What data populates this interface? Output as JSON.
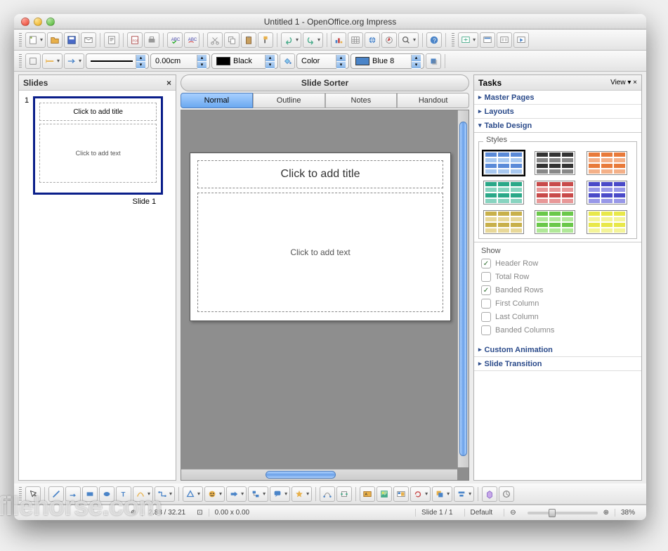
{
  "title": "Untitled 1 - OpenOffice.org Impress",
  "toolbar2": {
    "line_width": "0.00cm",
    "line_color_label": "Black",
    "area_label": "Color",
    "fill_color_label": "Blue 8"
  },
  "slides_panel": {
    "title": "Slides",
    "thumb_title": "Click to add title",
    "thumb_text": "Click to add text",
    "slide_number": "1",
    "slide_label": "Slide 1"
  },
  "center": {
    "sorter": "Slide Sorter",
    "tabs": [
      "Normal",
      "Outline",
      "Notes",
      "Handout"
    ],
    "slide_title": "Click to add title",
    "slide_text": "Click to add text"
  },
  "tasks": {
    "title": "Tasks",
    "view": "View",
    "sections": {
      "master": "Master Pages",
      "layouts": "Layouts",
      "table": "Table Design",
      "custom": "Custom Animation",
      "trans": "Slide Transition"
    },
    "styles_label": "Styles",
    "show_label": "Show",
    "show_opts": {
      "header": "Header Row",
      "total": "Total Row",
      "banded_rows": "Banded Rows",
      "first_col": "First Column",
      "last_col": "Last Column",
      "banded_cols": "Banded Columns"
    }
  },
  "status": {
    "pos": "2.88 / 32.21",
    "size": "0.00 x 0.00",
    "slide": "Slide 1 / 1",
    "template": "Default",
    "zoom": "38%"
  },
  "watermark": "filehorse.com"
}
